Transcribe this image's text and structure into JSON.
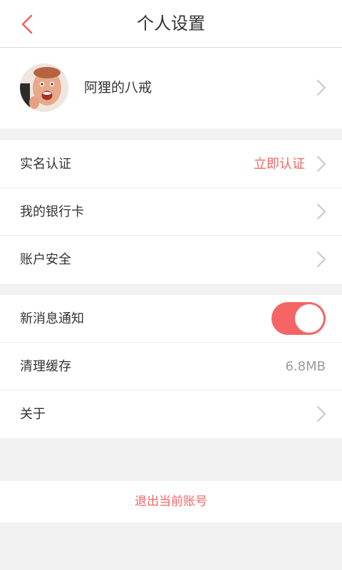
{
  "header": {
    "title": "个人设置",
    "back_icon": "chevron-left-icon"
  },
  "profile": {
    "name": "阿狸的八戒",
    "avatar": "avatar-photo"
  },
  "identity_group": {
    "items": [
      {
        "label": "实名认证",
        "value": "立即认证"
      },
      {
        "label": "我的银行卡"
      },
      {
        "label": "账户安全"
      }
    ]
  },
  "app_group": {
    "notifications": {
      "label": "新消息通知",
      "enabled": true
    },
    "cache": {
      "label": "清理缓存",
      "value": "6.8MB"
    },
    "about": {
      "label": "关于"
    }
  },
  "logout": {
    "label": "退出当前账号"
  },
  "colors": {
    "accent": "#f16565",
    "toggle_on": "#f56566",
    "chevron": "#c8c8c8",
    "background": "#f2f2f2"
  }
}
